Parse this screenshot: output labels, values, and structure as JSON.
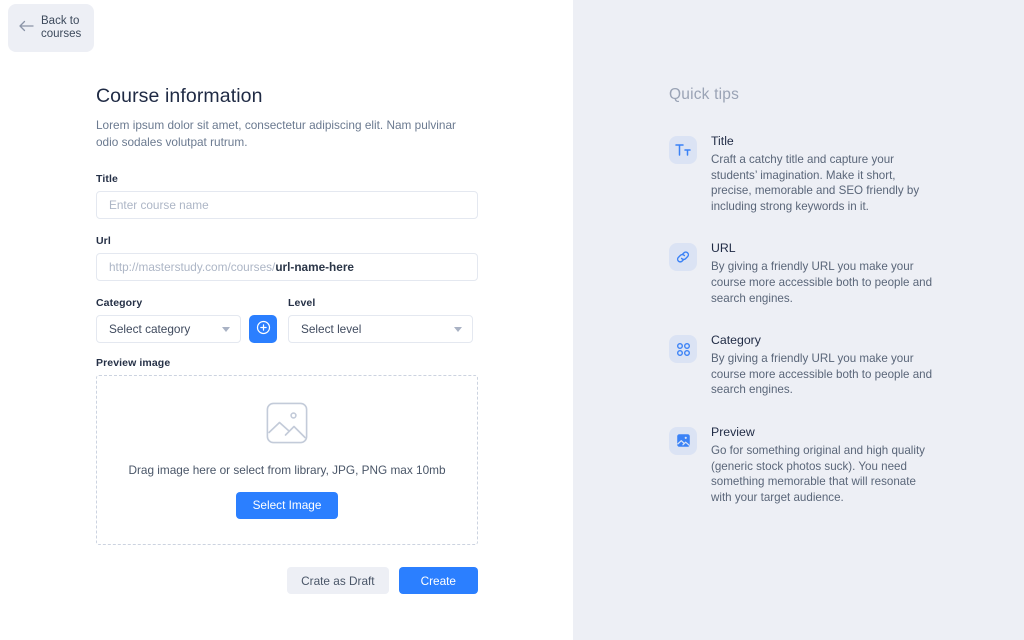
{
  "nav": {
    "back_label": "Back to courses",
    "back_icon": "arrow-left-icon"
  },
  "form": {
    "title": "Course information",
    "description": "Lorem ipsum dolor sit amet, consectetur adipiscing elit. Nam pulvinar odio sodales volutpat rutrum.",
    "fields": {
      "title": {
        "label": "Title",
        "value": "",
        "placeholder": "Enter course name"
      },
      "url": {
        "label": "Url",
        "value": "",
        "placeholder_prefix": "http://masterstudy.com/courses/",
        "placeholder_slug": "url-name-here"
      },
      "category": {
        "label": "Category",
        "selected": "Select category",
        "add_icon": "plus-circle-icon"
      },
      "level": {
        "label": "Level",
        "selected": "Select level"
      },
      "preview_image": {
        "label": "Preview image",
        "placeholder_icon": "image-placeholder-icon",
        "hint": "Drag image here or select from library, JPG, PNG max 10mb",
        "button_label": "Select Image"
      }
    },
    "actions": {
      "draft_label": "Crate as Draft",
      "create_label": "Create"
    }
  },
  "tips": {
    "heading": "Quick tips",
    "items": [
      {
        "icon": "text-format-icon",
        "title": "Title",
        "text": "Craft a catchy title and capture your students’ imagination. Make it short, precise, memorable and SEO friendly by including strong keywords in it."
      },
      {
        "icon": "link-icon",
        "title": "URL",
        "text": "By giving a friendly URL you make your course more accessible both to people and search engines."
      },
      {
        "icon": "grid-dots-icon",
        "title": "Category",
        "text": "By giving a friendly URL you make your course more accessible both to people and search engines."
      },
      {
        "icon": "image-icon",
        "title": "Preview",
        "text": "Go for something original and high quality (generic stock photos suck). You need something memorable that will resonate with your target audience."
      }
    ]
  },
  "colors": {
    "accent": "#2b7fff",
    "panel_bg": "#edeff5",
    "icon_tile": "#dbe3f4",
    "heading": "#1f2a44",
    "muted": "#6b7a90"
  }
}
